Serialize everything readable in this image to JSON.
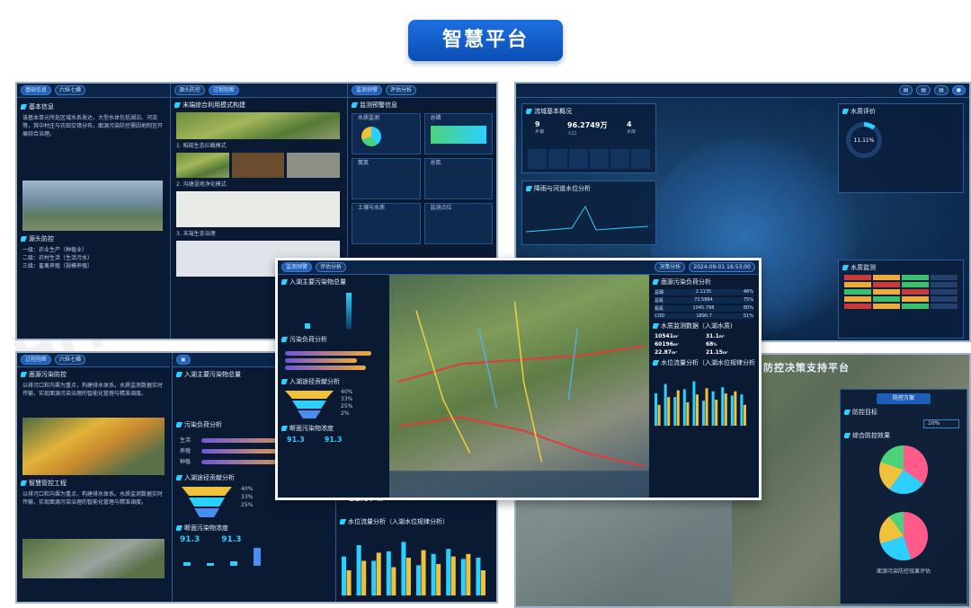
{
  "title": "智慧平台",
  "colors": {
    "title_bg": "#0b4fb5",
    "panel_bg": "#0a1a33",
    "accent": "#2bd0ff",
    "frame": "#9fb3c8"
  },
  "top_left": {
    "tabs": [
      "基础信息",
      "六纵七横"
    ],
    "section_profile": "基本信息",
    "section_control": "源头防控",
    "body": "该基本单元所处区域水系发达，大型水体包括湖泊、河流等，其中村庄与农田交错分布，面源污染防控需因地制宜开展综合治理。",
    "control_items": [
      "一级：农业生产（种植业）",
      "二级：农村生活（生活污水）",
      "三级：畜禽养殖（规模养殖）"
    ]
  },
  "top_mid": {
    "tabs": [
      "源头防控",
      "过程阻断"
    ],
    "section": "末端综合利用模式构建",
    "subhead_1": "1. 稻田生态拦截模式",
    "subhead_2": "2. 沟塘湿地净化模式",
    "subhead_3": "3. 末端生态治理"
  },
  "top_right": {
    "tabs": [
      "监测预警",
      "评估分析"
    ],
    "section": "监测预警信息",
    "labels": [
      "水质监测",
      "总磷",
      "氨氮",
      "总氮",
      "土壤与水质",
      "监测点位"
    ]
  },
  "right_top": {
    "section": "流域基本概况",
    "stats": [
      {
        "value": "9",
        "label": "乡镇"
      },
      {
        "value": "96.2749万",
        "label": "人口"
      },
      {
        "value": "4",
        "label": "水库"
      }
    ],
    "chart_title": "降雨与河道水位分析",
    "legend_title": "水质评价",
    "ring_value": "11.11%",
    "table_title": "水质监测"
  },
  "right_bottom": {
    "title": "防控决策支持平台",
    "section": "防控方案",
    "label_1": "防控目标",
    "select_value": "10%",
    "label_2": "综合防控效果",
    "caption": "面源污染防控效果评估"
  },
  "bottom_left": {
    "tabs": [
      "过程阻断",
      "六纵七横"
    ],
    "section_1": "面源污染防控",
    "section_2": "智慧管控工程",
    "body": "以排污口和沟渠为重点，构建排水体系。水质监测数据实时传输，实现面源污染治理的智能化管理与精准调度。"
  },
  "bottom_mid": {
    "section_1": "入湖主要污染物总量",
    "section_2": "污染负荷分析",
    "section_3": "入湖途径贡献分析",
    "section_4": "断面污染物浓度",
    "percent": [
      "40%",
      "33%",
      "25%",
      "2%"
    ],
    "bars": [
      "生活",
      "养殖",
      "种植"
    ],
    "val_a": "91.3",
    "val_b": "91.3",
    "unit": "t/a"
  },
  "bottom_right": {
    "value": "22.87",
    "unit": "m³",
    "chart_title": "水位流量分析（入湖水位规律分析）"
  },
  "center": {
    "tabs": [
      "监测预警",
      "评估分析",
      "决策分析"
    ],
    "timestamp": "2024-09-01 16:53:00",
    "left_section_1": "入湖主要污染物总量",
    "left_section_2": "污染负荷分析",
    "left_section_3": "入湖途径贡献分析",
    "left_section_4": "断面污染物浓度",
    "left_vals": [
      "91.3",
      "91.3"
    ],
    "left_unit": "t/a",
    "funnel_pct": [
      "40%",
      "33%",
      "25%",
      "2%"
    ],
    "right_section_1": "面源污染负荷分析",
    "right_rows": [
      {
        "name": "总磷",
        "value": "2.1135",
        "pct": "46%"
      },
      {
        "name": "总氮",
        "value": "73.5884",
        "pct": "75%"
      },
      {
        "name": "氨氮",
        "value": "1045.798",
        "pct": "80%"
      },
      {
        "name": "COD",
        "value": "1890.7",
        "pct": "51%"
      }
    ],
    "right_section_2": "水质监测数据（入湖水质)",
    "gauges": [
      {
        "value": "10541",
        "unit": "m³"
      },
      {
        "value": "31.1",
        "unit": "m³"
      },
      {
        "value": "60196",
        "unit": "m³"
      },
      {
        "value": "68",
        "unit": "%"
      },
      {
        "value": "22.87",
        "unit": "m³"
      },
      {
        "value": "21.15",
        "unit": "m³"
      }
    ],
    "right_section_3": "水位流量分析（入湖水位规律分析）"
  },
  "chart_data": {
    "type": "bar",
    "categories": [
      "1",
      "2",
      "3",
      "4",
      "5",
      "6",
      "7",
      "8",
      "9",
      "10"
    ],
    "series": [
      {
        "values": [
          62,
          80,
          55,
          70,
          85,
          48,
          66,
          74,
          58,
          60
        ]
      },
      {
        "values": [
          40,
          55,
          68,
          45,
          60,
          72,
          50,
          62,
          66,
          40
        ]
      }
    ],
    "ylim": [
      0,
      100
    ]
  }
}
